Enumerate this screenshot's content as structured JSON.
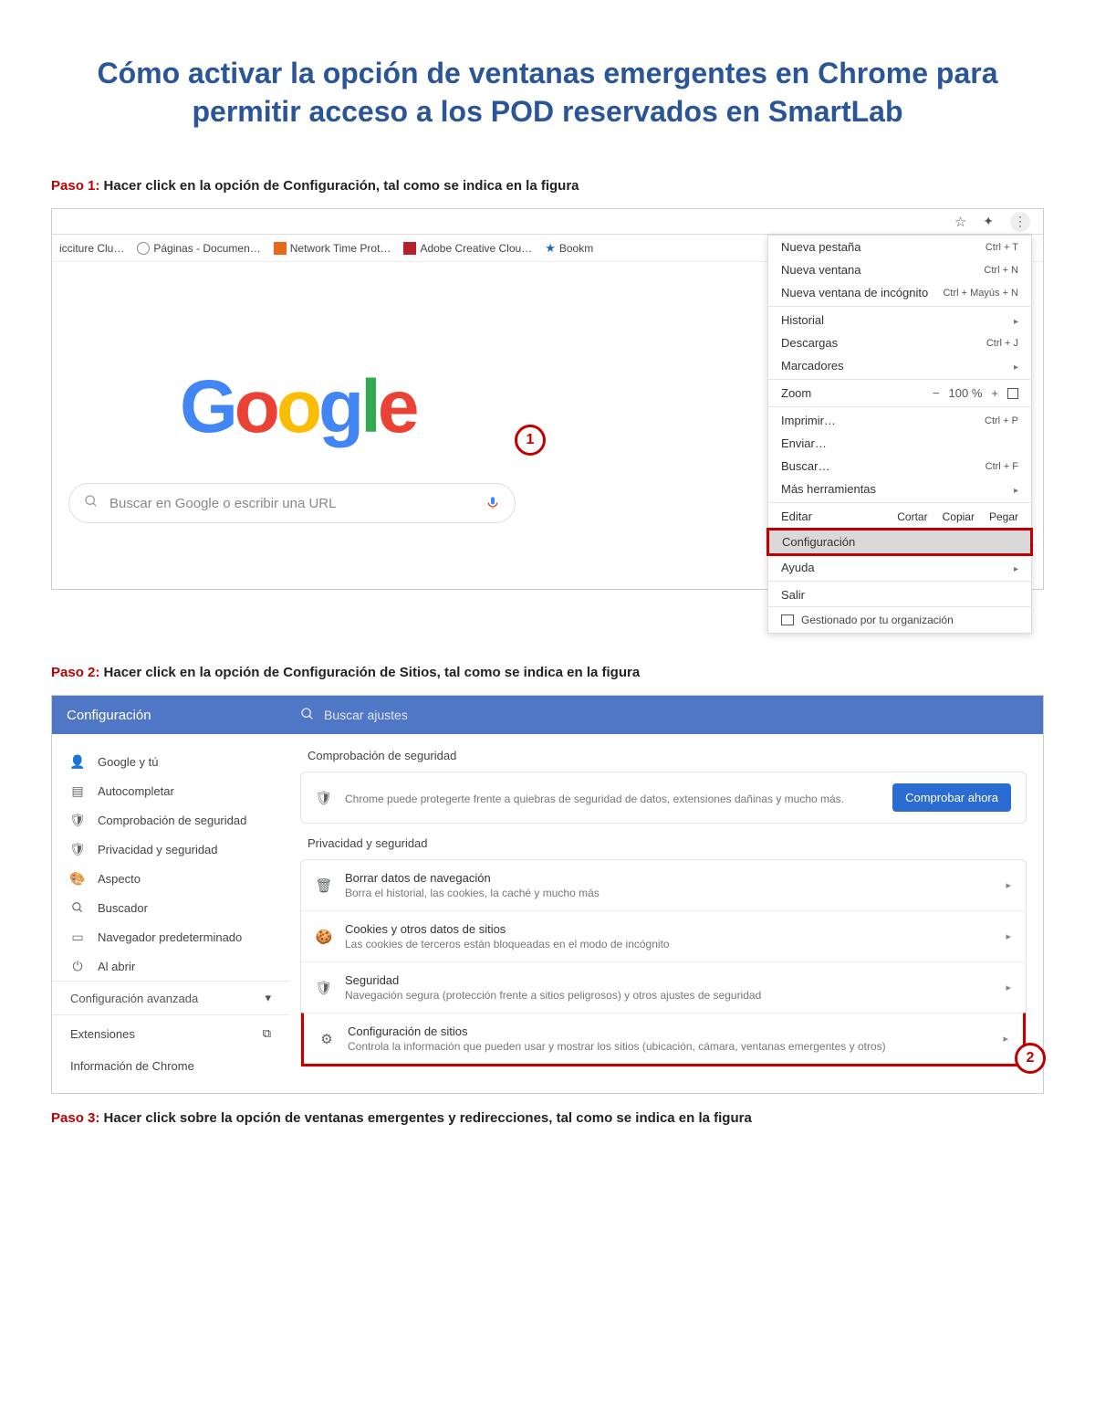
{
  "doc": {
    "title": "Cómo activar la opción de ventanas emergentes en Chrome para permitir acceso a los POD reservados en SmartLab",
    "step1_label": "Paso 1:",
    "step1_text": "Hacer click en la opción de Configuración, tal como se indica en la figura",
    "step2_label": "Paso 2:",
    "step2_text": "Hacer click en la opción de Configuración de Sitios, tal como se indica en la figura",
    "step3_label": "Paso 3:",
    "step3_text": "Hacer click sobre la opción de ventanas emergentes y redirecciones, tal como se indica en la figura"
  },
  "fig1": {
    "bookmarks": {
      "b0": "icciture Clu…",
      "b1": "Páginas - Documen…",
      "b2": "Network Time Prot…",
      "b3": "Adobe Creative Clou…",
      "b4": "Bookm"
    },
    "search_placeholder": "Buscar en Google o escribir una URL",
    "callout1": "1",
    "menu": {
      "new_tab": "Nueva pestaña",
      "new_tab_sc": "Ctrl + T",
      "new_win": "Nueva ventana",
      "new_win_sc": "Ctrl + N",
      "new_inc": "Nueva ventana de incógnito",
      "new_inc_sc": "Ctrl + Mayús + N",
      "history": "Historial",
      "downloads": "Descargas",
      "downloads_sc": "Ctrl + J",
      "bookmarks": "Marcadores",
      "zoom": "Zoom",
      "zoom_minus": "−",
      "zoom_pct": "100 %",
      "zoom_plus": "+",
      "print": "Imprimir…",
      "print_sc": "Ctrl + P",
      "cast": "Enviar…",
      "find": "Buscar…",
      "find_sc": "Ctrl + F",
      "more": "Más herramientas",
      "edit": "Editar",
      "cut": "Cortar",
      "copy": "Copiar",
      "paste": "Pegar",
      "settings": "Configuración",
      "help": "Ayuda",
      "exit": "Salir",
      "managed": "Gestionado por tu organización"
    }
  },
  "fig2": {
    "header_title": "Configuración",
    "search_placeholder": "Buscar ajustes",
    "callout2": "2",
    "side": {
      "you": "Google y tú",
      "autofill": "Autocompletar",
      "safety": "Comprobación de seguridad",
      "privacy": "Privacidad y seguridad",
      "appearance": "Aspecto",
      "search": "Buscador",
      "default": "Navegador predeterminado",
      "startup": "Al abrir",
      "advanced": "Configuración avanzada",
      "extensions": "Extensiones",
      "about": "Información de Chrome"
    },
    "sections": {
      "check_title": "Comprobación de seguridad",
      "check_desc": "Chrome puede protegerte frente a quiebras de seguridad de datos, extensiones dañinas y mucho más.",
      "check_btn": "Comprobar ahora",
      "privacy_title": "Privacidad y seguridad",
      "row1_t": "Borrar datos de navegación",
      "row1_d": "Borra el historial, las cookies, la caché y mucho más",
      "row2_t": "Cookies y otros datos de sitios",
      "row2_d": "Las cookies de terceros están bloqueadas en el modo de incógnito",
      "row3_t": "Seguridad",
      "row3_d": "Navegación segura (protección frente a sitios peligrosos) y otros ajustes de seguridad",
      "row4_t": "Configuración de sitios",
      "row4_d": "Controla la información que pueden usar y mostrar los sitios (ubicación, cámara, ventanas emergentes y otros)"
    }
  }
}
